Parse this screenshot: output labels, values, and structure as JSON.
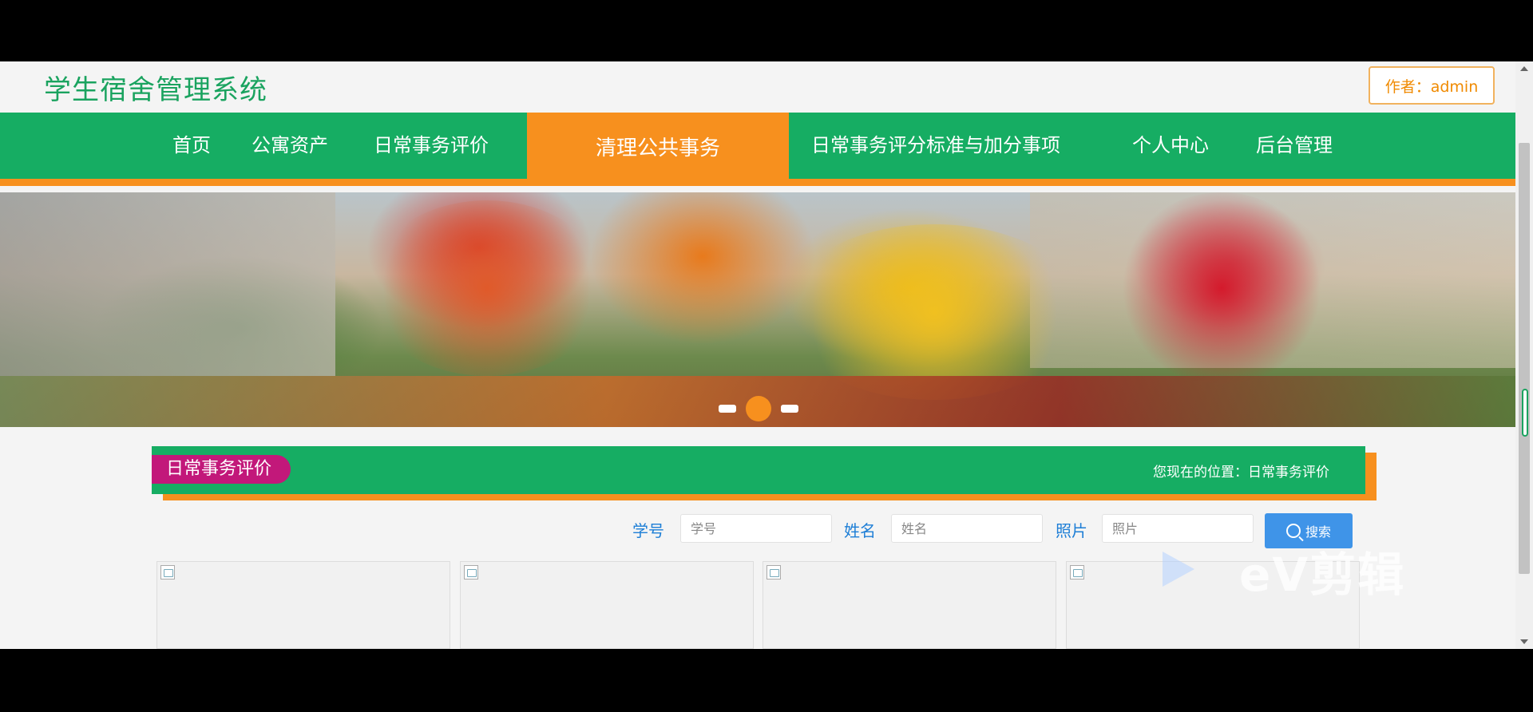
{
  "header": {
    "site_title": "学生宿舍管理系统",
    "author_label": "作者：admin"
  },
  "nav": {
    "items": [
      {
        "label": "首页"
      },
      {
        "label": "公寓资产"
      },
      {
        "label": "日常事务评价"
      },
      {
        "label": "清理公共事务",
        "active": true
      },
      {
        "label": "日常事务评分标准与加分事项"
      },
      {
        "label": "个人中心"
      },
      {
        "label": "后台管理"
      }
    ]
  },
  "banner": {
    "slides_count": 3,
    "active_slide": 2
  },
  "section": {
    "title": "日常事务评价",
    "breadcrumb": "您现在的位置：日常事务评价"
  },
  "search": {
    "fields": [
      {
        "label": "学号",
        "placeholder": "学号"
      },
      {
        "label": "姓名",
        "placeholder": "姓名"
      },
      {
        "label": "照片",
        "placeholder": "照片"
      }
    ],
    "button_label": "搜索",
    "button_icon": "search-icon"
  },
  "colors": {
    "brand_green": "#16ad63",
    "accent_orange": "#f7901e",
    "tag_magenta": "#c2187a",
    "search_blue": "#3f94e8"
  },
  "watermark": {
    "text": "eV剪辑"
  }
}
